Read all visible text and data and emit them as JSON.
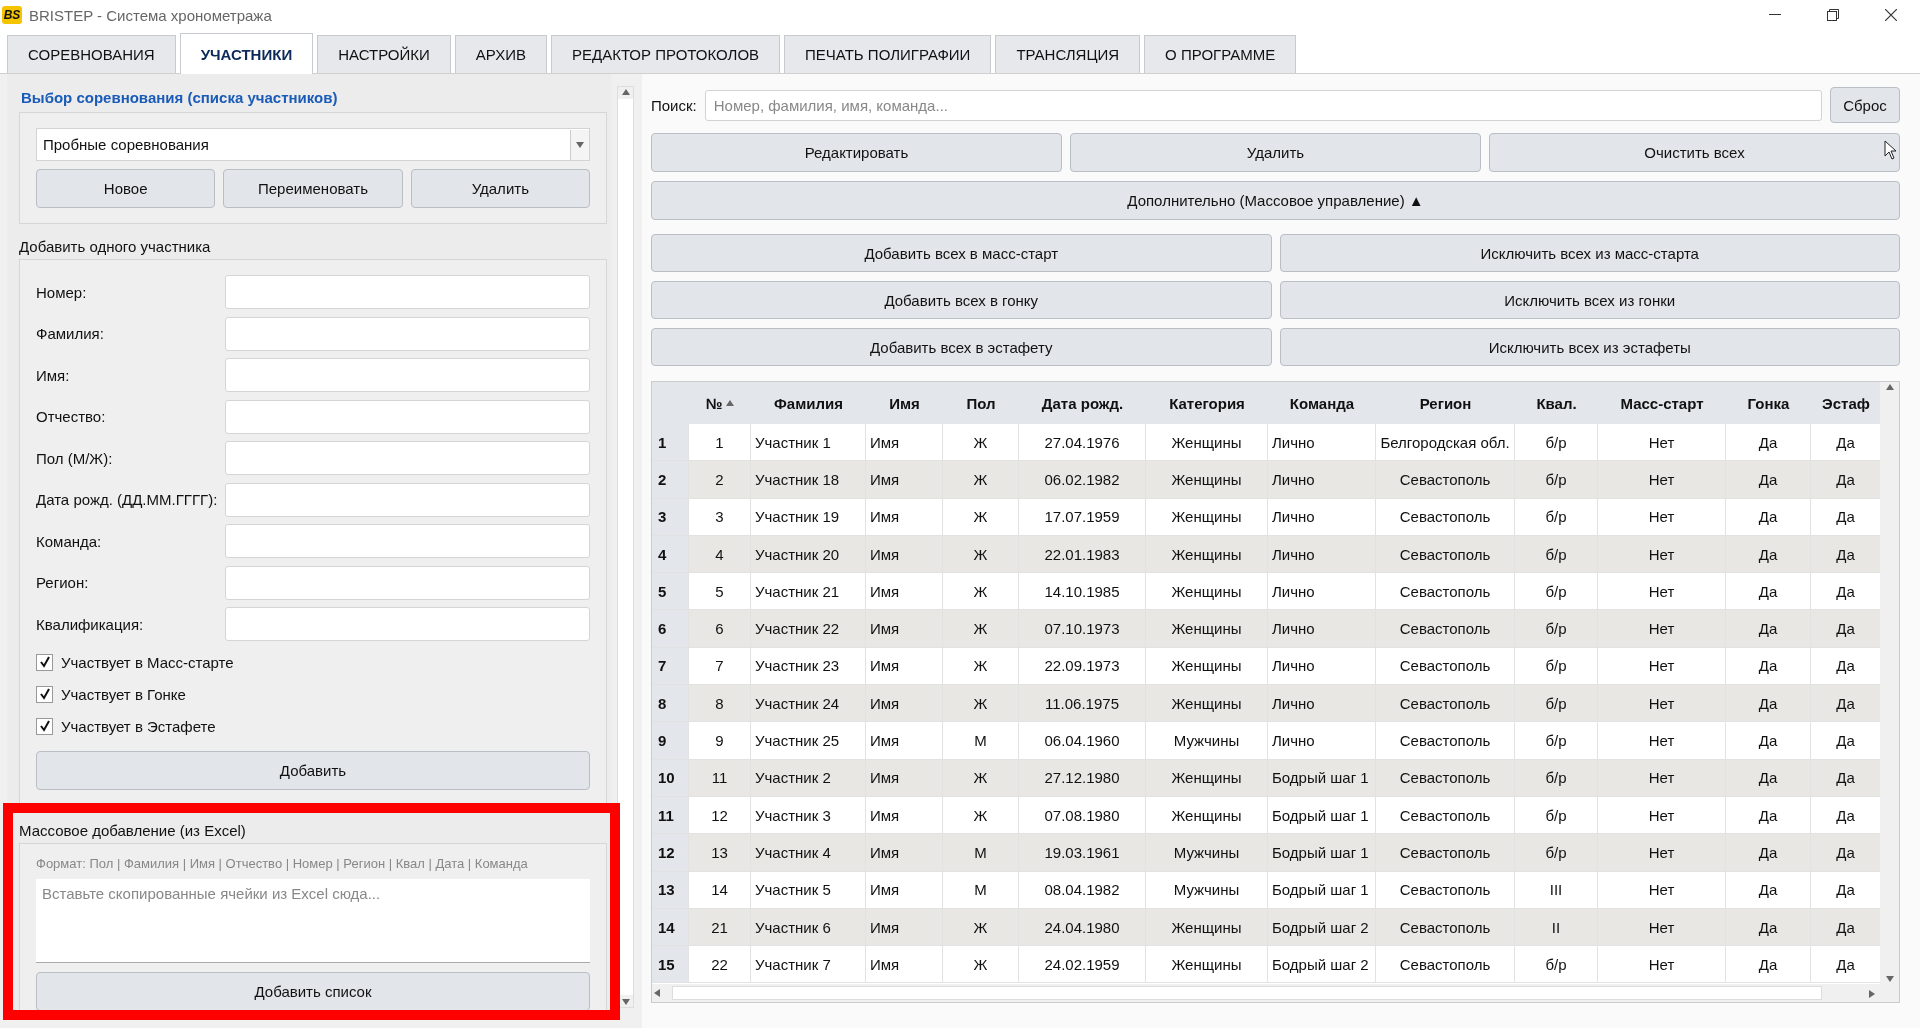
{
  "window": {
    "title": "BRISTEP - Система хронометража",
    "logo": "BS"
  },
  "tabs": [
    {
      "label": "СОРЕВНОВАНИЯ",
      "selected": false
    },
    {
      "label": "УЧАСТНИКИ",
      "selected": true
    },
    {
      "label": "НАСТРОЙКИ",
      "selected": false
    },
    {
      "label": "АРХИВ",
      "selected": false
    },
    {
      "label": "РЕДАКТОР ПРОТОКОЛОВ",
      "selected": false
    },
    {
      "label": "ПЕЧАТЬ ПОЛИГРАФИИ",
      "selected": false
    },
    {
      "label": "ТРАНСЛЯЦИЯ",
      "selected": false
    },
    {
      "label": "О ПРОГРАММЕ",
      "selected": false
    }
  ],
  "competition": {
    "heading": "Выбор соревнования (списка участников)",
    "value": "Пробные соревнования",
    "buttons": [
      "Новое",
      "Переименовать",
      "Удалить"
    ]
  },
  "single_add": {
    "heading": "Добавить одного участника",
    "fields": [
      {
        "label": "Номер:"
      },
      {
        "label": "Фамилия:"
      },
      {
        "label": "Имя:"
      },
      {
        "label": "Отчество:"
      },
      {
        "label": "Пол (М/Ж):"
      },
      {
        "label": "Дата рожд. (ДД.ММ.ГГГГ):"
      },
      {
        "label": "Команда:"
      },
      {
        "label": "Регион:"
      },
      {
        "label": "Квалификация:"
      }
    ],
    "checkboxes": [
      {
        "label": "Участвует в Масс-старте",
        "checked": true
      },
      {
        "label": "Участвует в Гонке",
        "checked": true
      },
      {
        "label": "Участвует в Эстафете",
        "checked": true
      }
    ],
    "button": "Добавить"
  },
  "bulk_add": {
    "heading": "Массовое добавление (из Excel)",
    "highlighted": true,
    "format_hint": "Формат: Пол | Фамилия | Имя | Отчество | Номер | Регион | Квал | Дата | Команда",
    "placeholder": "Вставьте скопированные ячейки из Excel сюда...",
    "button": "Добавить список"
  },
  "search": {
    "label": "Поиск:",
    "placeholder": "Номер, фамилия, имя, команда...",
    "reset": "Сброс"
  },
  "actions": [
    "Редактировать",
    "Удалить",
    "Очистить всех"
  ],
  "more_button": "Дополнительно (Массовое управление) ▲",
  "bulk_actions": [
    "Добавить всех в масс-старт",
    "Исключить всех из масс-старта",
    "Добавить всех в гонку",
    "Исключить всех из гонки",
    "Добавить всех в эстафету",
    "Исключить всех из эстафеты"
  ],
  "table": {
    "columns": [
      {
        "label": "№",
        "sorted_ascending": true
      },
      {
        "label": "Фамилия"
      },
      {
        "label": "Имя"
      },
      {
        "label": "Пол"
      },
      {
        "label": "Дата рожд."
      },
      {
        "label": "Категория"
      },
      {
        "label": "Команда"
      },
      {
        "label": "Регион"
      },
      {
        "label": "Квал."
      },
      {
        "label": "Масс-старт"
      },
      {
        "label": "Гонка"
      },
      {
        "label": "Эстаф"
      }
    ],
    "rows": [
      {
        "index": "1",
        "cells": [
          "1",
          "Участник 1",
          "Имя",
          "Ж",
          "27.04.1976",
          "Женщины",
          "Лично",
          "Белгородская обл.",
          "б/р",
          "Нет",
          "Да",
          "Да"
        ]
      },
      {
        "index": "2",
        "cells": [
          "2",
          "Участник 18",
          "Имя",
          "Ж",
          "06.02.1982",
          "Женщины",
          "Лично",
          "Севастополь",
          "б/р",
          "Нет",
          "Да",
          "Да"
        ]
      },
      {
        "index": "3",
        "cells": [
          "3",
          "Участник 19",
          "Имя",
          "Ж",
          "17.07.1959",
          "Женщины",
          "Лично",
          "Севастополь",
          "б/р",
          "Нет",
          "Да",
          "Да"
        ]
      },
      {
        "index": "4",
        "cells": [
          "4",
          "Участник 20",
          "Имя",
          "Ж",
          "22.01.1983",
          "Женщины",
          "Лично",
          "Севастополь",
          "б/р",
          "Нет",
          "Да",
          "Да"
        ]
      },
      {
        "index": "5",
        "cells": [
          "5",
          "Участник 21",
          "Имя",
          "Ж",
          "14.10.1985",
          "Женщины",
          "Лично",
          "Севастополь",
          "б/р",
          "Нет",
          "Да",
          "Да"
        ]
      },
      {
        "index": "6",
        "cells": [
          "6",
          "Участник 22",
          "Имя",
          "Ж",
          "07.10.1973",
          "Женщины",
          "Лично",
          "Севастополь",
          "б/р",
          "Нет",
          "Да",
          "Да"
        ]
      },
      {
        "index": "7",
        "cells": [
          "7",
          "Участник 23",
          "Имя",
          "Ж",
          "22.09.1973",
          "Женщины",
          "Лично",
          "Севастополь",
          "б/р",
          "Нет",
          "Да",
          "Да"
        ]
      },
      {
        "index": "8",
        "cells": [
          "8",
          "Участник 24",
          "Имя",
          "Ж",
          "11.06.1975",
          "Женщины",
          "Лично",
          "Севастополь",
          "б/р",
          "Нет",
          "Да",
          "Да"
        ]
      },
      {
        "index": "9",
        "cells": [
          "9",
          "Участник 25",
          "Имя",
          "М",
          "06.04.1960",
          "Мужчины",
          "Лично",
          "Севастополь",
          "б/р",
          "Нет",
          "Да",
          "Да"
        ]
      },
      {
        "index": "10",
        "cells": [
          "11",
          "Участник 2",
          "Имя",
          "Ж",
          "27.12.1980",
          "Женщины",
          "Бодрый шаг 1",
          "Севастополь",
          "б/р",
          "Нет",
          "Да",
          "Да"
        ]
      },
      {
        "index": "11",
        "cells": [
          "12",
          "Участник 3",
          "Имя",
          "Ж",
          "07.08.1980",
          "Женщины",
          "Бодрый шаг 1",
          "Севастополь",
          "б/р",
          "Нет",
          "Да",
          "Да"
        ]
      },
      {
        "index": "12",
        "cells": [
          "13",
          "Участник 4",
          "Имя",
          "М",
          "19.03.1961",
          "Мужчины",
          "Бодрый шаг 1",
          "Севастополь",
          "б/р",
          "Нет",
          "Да",
          "Да"
        ]
      },
      {
        "index": "13",
        "cells": [
          "14",
          "Участник 5",
          "Имя",
          "М",
          "08.04.1982",
          "Мужчины",
          "Бодрый шаг 1",
          "Севастополь",
          "III",
          "Нет",
          "Да",
          "Да"
        ]
      },
      {
        "index": "14",
        "cells": [
          "21",
          "Участник 6",
          "Имя",
          "Ж",
          "24.04.1980",
          "Женщины",
          "Бодрый шаг 2",
          "Севастополь",
          "II",
          "Нет",
          "Да",
          "Да"
        ]
      },
      {
        "index": "15",
        "cells": [
          "22",
          "Участник 7",
          "Имя",
          "Ж",
          "24.02.1959",
          "Женщины",
          "Бодрый шаг 2",
          "Севастополь",
          "б/р",
          "Нет",
          "Да",
          "Да"
        ]
      }
    ]
  }
}
